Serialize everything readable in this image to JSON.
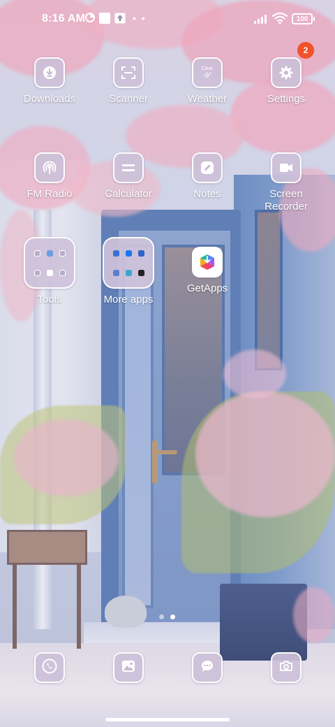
{
  "status_bar": {
    "time": "8:16 AM",
    "battery": "100",
    "more_indicator": "• •"
  },
  "apps": [
    {
      "label": "Downloads",
      "icon": "download-icon"
    },
    {
      "label": "Scanner",
      "icon": "scanner-icon"
    },
    {
      "label": "Weather",
      "icon": "weather-icon",
      "icon_text_top": "Clear",
      "icon_text_bottom": "-9°"
    },
    {
      "label": "Settings",
      "icon": "gear-icon",
      "badge": "2"
    },
    {
      "label": "FM Radio",
      "icon": "radio-icon"
    },
    {
      "label": "Calculator",
      "icon": "calculator-icon"
    },
    {
      "label": "Notes",
      "icon": "pencil-icon"
    },
    {
      "label": "Screen\nRecorder",
      "icon": "video-camera-icon"
    },
    {
      "label": "Tools",
      "icon": "folder-icon"
    },
    {
      "label": "More apps",
      "icon": "folder-icon"
    },
    {
      "label": "GetApps",
      "icon": "getapps-icon"
    }
  ],
  "page_indicator": {
    "pages": 2,
    "current": 2
  },
  "dock": [
    {
      "icon": "phone-icon"
    },
    {
      "icon": "gallery-icon"
    },
    {
      "icon": "messages-icon"
    },
    {
      "icon": "camera-icon"
    }
  ],
  "colors": {
    "badge": "#f0532a",
    "icon_bg": "#ccc0d8",
    "label": "#ffffff"
  }
}
